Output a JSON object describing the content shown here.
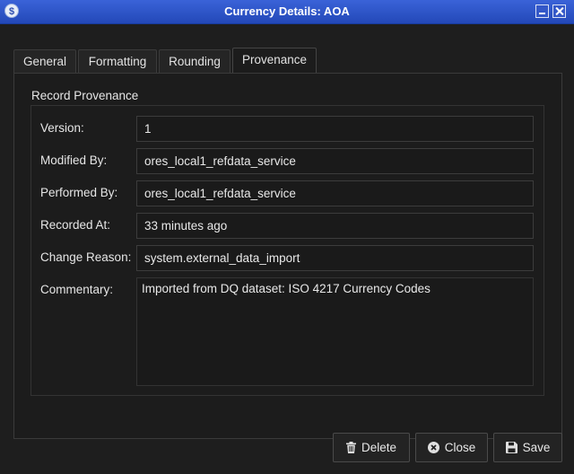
{
  "window": {
    "title": "Currency Details: AOA"
  },
  "tabs": [
    {
      "label": "General"
    },
    {
      "label": "Formatting"
    },
    {
      "label": "Rounding"
    },
    {
      "label": "Provenance"
    }
  ],
  "active_tab": "Provenance",
  "provenance": {
    "group_title": "Record Provenance",
    "version_label": "Version:",
    "version_value": "1",
    "modified_by_label": "Modified By:",
    "modified_by_value": "ores_local1_refdata_service",
    "performed_by_label": "Performed By:",
    "performed_by_value": "ores_local1_refdata_service",
    "recorded_at_label": "Recorded At:",
    "recorded_at_value": "33 minutes ago",
    "change_reason_label": "Change Reason:",
    "change_reason_value": "system.external_data_import",
    "commentary_label": "Commentary:",
    "commentary_value": "Imported from DQ dataset: ISO 4217 Currency Codes"
  },
  "buttons": {
    "delete_label": "Delete",
    "close_label": "Close",
    "save_label": "Save"
  },
  "icons": {
    "app": "currency-icon",
    "delete": "trash-icon",
    "close": "close-circle-icon",
    "save": "floppy-disk-icon"
  },
  "colors": {
    "titlebar": "#2d54c8",
    "background": "#1e1e1e",
    "field_background": "#1a1a1a"
  }
}
